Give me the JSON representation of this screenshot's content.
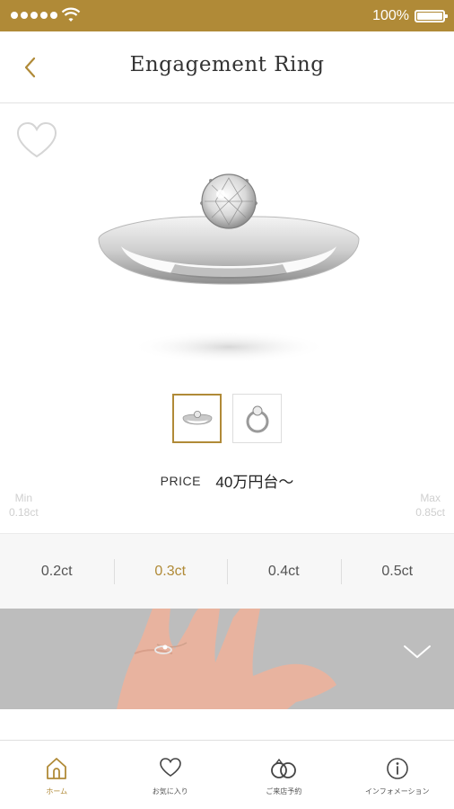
{
  "status_bar": {
    "battery_text": "100%",
    "battery_level": 1.0,
    "signal_icon": "signal-dots-icon",
    "wifi_icon": "wifi-icon"
  },
  "header": {
    "title": "Engagement Ring",
    "back_icon": "chevron-left-icon"
  },
  "product": {
    "favorite_icon": "heart-outline-icon",
    "image": "ring-photo",
    "thumbnails": [
      {
        "icon": "ring-side-view-thumb",
        "selected": true
      },
      {
        "icon": "ring-top-view-thumb",
        "selected": false
      }
    ],
    "price_label": "PRICE",
    "price_value": "40万円台〜"
  },
  "carat_range": {
    "min_label": "Min",
    "min_value": "0.18ct",
    "max_label": "Max",
    "max_value": "0.85ct"
  },
  "carat_options": [
    {
      "label": "0.2ct",
      "active": false
    },
    {
      "label": "0.3ct",
      "active": true
    },
    {
      "label": "0.4ct",
      "active": false
    },
    {
      "label": "0.5ct",
      "active": false
    }
  ],
  "banner": {
    "image": "hand-wearing-ring-photo",
    "expand_icon": "chevron-down-icon"
  },
  "tabs": [
    {
      "label": "ホーム",
      "icon": "home-icon",
      "active": true
    },
    {
      "label": "お気に入り",
      "icon": "heart-icon",
      "active": false
    },
    {
      "label": "ご来店予約",
      "icon": "rings-icon",
      "active": false
    },
    {
      "label": "インフォメーション",
      "icon": "info-icon",
      "active": false
    }
  ],
  "colors": {
    "accent": "#b08a37",
    "text": "#333333",
    "muted": "#cfcfcf"
  }
}
